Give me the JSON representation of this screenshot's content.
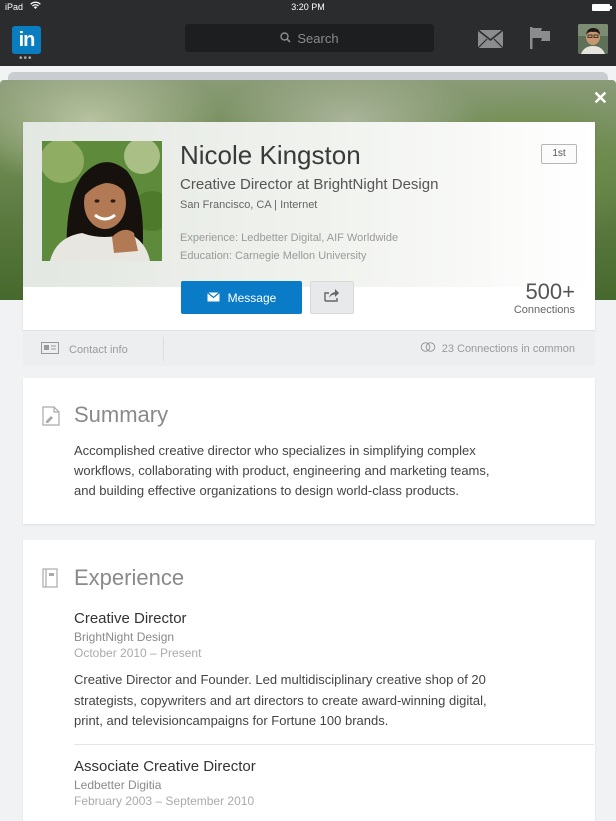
{
  "status_bar": {
    "carrier": "iPad",
    "time": "3:20 PM"
  },
  "nav": {
    "logo": "in",
    "search_placeholder": "Search"
  },
  "profile": {
    "name": "Nicole Kingston",
    "headline": "Creative Director at BrightNight Design",
    "location": "San Francisco, CA | Internet",
    "experience_line": "Experience: Ledbetter Digital, AIF Worldwide",
    "education_line": "Education: Carnegie Mellon University",
    "degree": "1st",
    "message_label": "Message",
    "connections_count": "500+",
    "connections_label": "Connections"
  },
  "strip": {
    "contact_label": "Contact info",
    "common_label": "23 Connections in common"
  },
  "summary": {
    "title": "Summary",
    "lines": [
      "Accomplished creative director who specializes in simplifying complex",
      "workflows, collaborating with product, engineering and marketing teams,",
      "and building effective organizations to design world-class products."
    ]
  },
  "experience": {
    "title": "Experience",
    "jobs": [
      {
        "title": "Creative Director",
        "company": "BrightNight Design",
        "dates": "October 2010 – Present",
        "desc_lines": [
          "Creative Director and Founder. Led multidisciplinary creative shop of 20",
          "strategists, copywriters and art directors to create award-winning digital,",
          "print, and televisioncampaigns for Fortune 100 brands."
        ]
      },
      {
        "title": "Associate Creative Director",
        "company": "Ledbetter Digitia",
        "dates": "February 2003 – September 2010"
      }
    ]
  },
  "colors": {
    "linkedin_blue": "#0a7bc7",
    "nav_bg": "#2b2c2e"
  },
  "icons": [
    "mail-icon",
    "flag-icon",
    "search-icon",
    "close-icon",
    "share-icon",
    "contact-card-icon",
    "connections-icon",
    "summary-doc-icon",
    "experience-book-icon"
  ]
}
